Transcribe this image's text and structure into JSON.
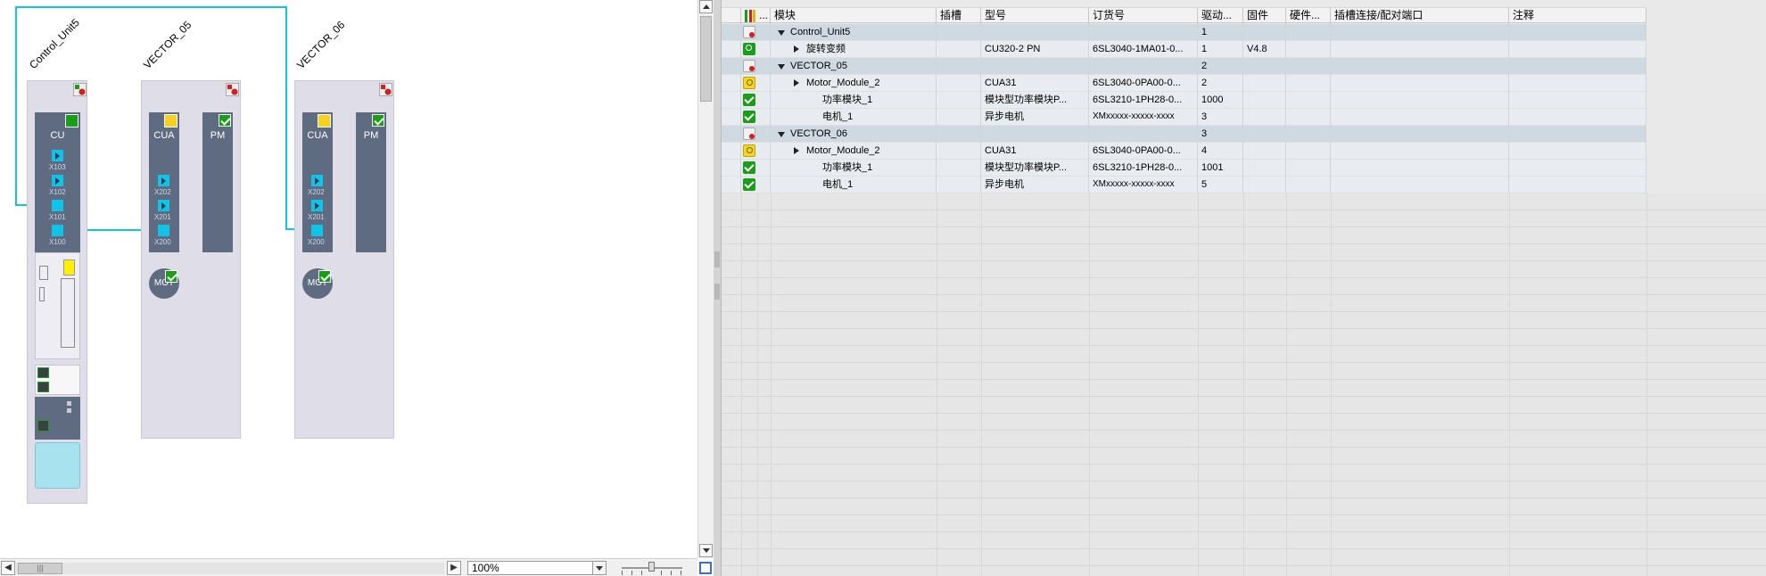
{
  "topology": {
    "devices": [
      {
        "name": "Control_Unit5",
        "modules": [
          {
            "label": "CU",
            "ports": [
              "X103",
              "X102",
              "X101",
              "X100"
            ]
          }
        ]
      },
      {
        "name": "VECTOR_05",
        "modules": [
          {
            "label": "CUA",
            "ports": [
              "X202",
              "X201",
              "X200"
            ]
          },
          {
            "label": "PM",
            "ports": []
          }
        ],
        "motor": "MOT"
      },
      {
        "name": "VECTOR_06",
        "modules": [
          {
            "label": "CUA",
            "ports": [
              "X202",
              "X201",
              "X200"
            ]
          },
          {
            "label": "PM",
            "ports": []
          }
        ],
        "motor": "MOT"
      }
    ]
  },
  "bottom_bar": {
    "zoom": "100%"
  },
  "table": {
    "columns": [
      "",
      "...",
      "模块",
      "插槽",
      "型号",
      "订货号",
      "驱动...",
      "固件",
      "硬件...",
      "插槽连接/配对端口",
      "注释"
    ],
    "rows": [
      {
        "status": "err",
        "level": 0,
        "expander": "open",
        "module": "Control_Unit5",
        "slot": "",
        "type": "",
        "order": "",
        "drive": "1",
        "fw": "",
        "hw": ""
      },
      {
        "status": "wrench",
        "level": 1,
        "expander": "closed",
        "module": "旋转变频",
        "slot": "",
        "type": "CU320-2 PN",
        "order": "6SL3040-1MA01-0...",
        "drive": "1",
        "fw": "V4.8",
        "hw": ""
      },
      {
        "status": "err",
        "level": 0,
        "expander": "open",
        "module": "VECTOR_05",
        "slot": "",
        "type": "",
        "order": "",
        "drive": "2",
        "fw": "",
        "hw": ""
      },
      {
        "status": "warn",
        "level": 1,
        "expander": "closed",
        "module": "Motor_Module_2",
        "slot": "",
        "type": "CUA31",
        "order": "6SL3040-0PA00-0...",
        "drive": "2",
        "fw": "",
        "hw": ""
      },
      {
        "status": "ok",
        "level": 2,
        "expander": "",
        "module": "功率模块_1",
        "slot": "",
        "type": "模块型功率模块P...",
        "order": "6SL3210-1PH28-0...",
        "drive": "1000",
        "fw": "",
        "hw": ""
      },
      {
        "status": "ok",
        "level": 2,
        "expander": "",
        "module": "电机_1",
        "slot": "",
        "type": "异步电机",
        "order": "XMxxxxx-xxxxx-xxxx",
        "drive": "3",
        "fw": "",
        "hw": ""
      },
      {
        "status": "err",
        "level": 0,
        "expander": "open",
        "module": "VECTOR_06",
        "slot": "",
        "type": "",
        "order": "",
        "drive": "3",
        "fw": "",
        "hw": ""
      },
      {
        "status": "warn",
        "level": 1,
        "expander": "closed",
        "module": "Motor_Module_2",
        "slot": "",
        "type": "CUA31",
        "order": "6SL3040-0PA00-0...",
        "drive": "4",
        "fw": "",
        "hw": ""
      },
      {
        "status": "ok",
        "level": 2,
        "expander": "",
        "module": "功率模块_1",
        "slot": "",
        "type": "模块型功率模块P...",
        "order": "6SL3210-1PH28-0...",
        "drive": "1001",
        "fw": "",
        "hw": ""
      },
      {
        "status": "ok",
        "level": 2,
        "expander": "",
        "module": "电机_1",
        "slot": "",
        "type": "异步电机",
        "order": "XMxxxxx-xxxxx-xxxx",
        "drive": "5",
        "fw": "",
        "hw": ""
      }
    ]
  },
  "colors": {
    "wire": "#12c3e8",
    "module": "#5e6b80",
    "device": "#dedde8",
    "group_row": "#cfd9e2",
    "ok": "#1a9e1a",
    "warn": "#f3d52a",
    "error": "#d02020"
  }
}
